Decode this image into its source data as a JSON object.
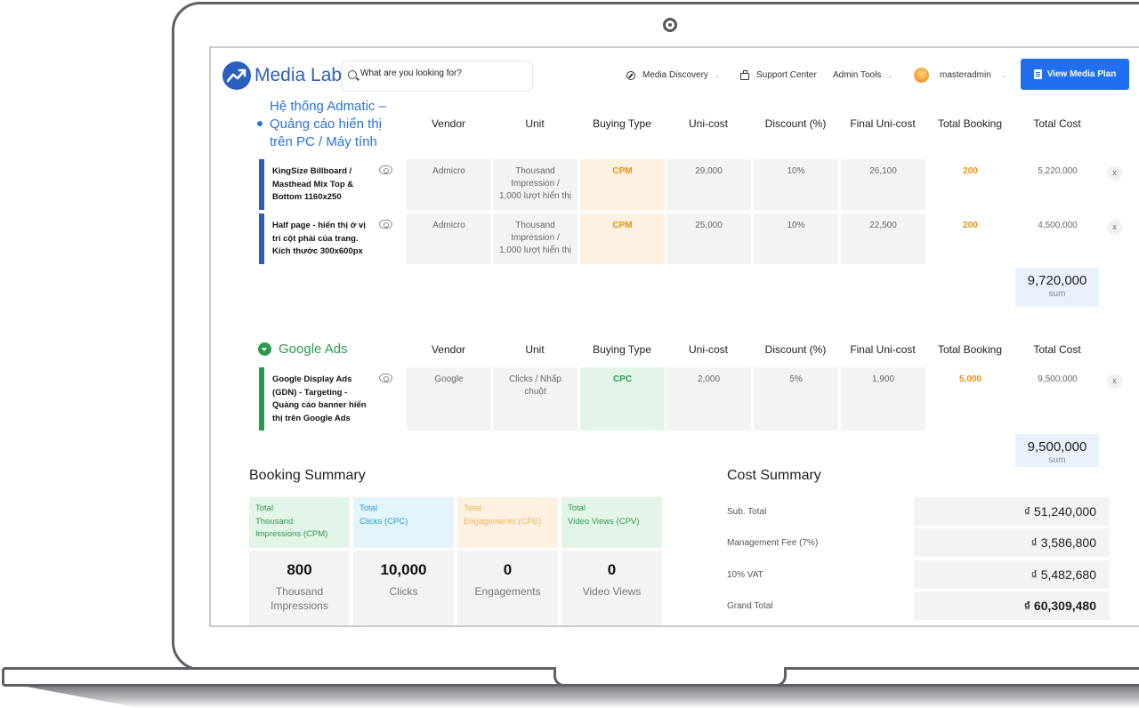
{
  "header": {
    "brand": "Media Lab",
    "search_placeholder": "What are you looking for?",
    "nav": [
      {
        "label": "Media Discovery",
        "icon": "compass-icon"
      },
      {
        "label": "Support Center",
        "icon": "bag-icon"
      },
      {
        "label": "Admin Tools",
        "icon": ""
      },
      {
        "label": "masteradmin",
        "icon": "avatar"
      }
    ],
    "plan_button": "View Media Plan",
    "accent": "#1f6ff0"
  },
  "columns": [
    "Vendor",
    "Unit",
    "Buying Type",
    "Uni-cost",
    "Discount (%)",
    "Final Uni-cost",
    "Total Booking",
    "Total Cost"
  ],
  "admatic": {
    "title_lines": [
      "Hệ thống Admatic –",
      "Quảng cáo hiển thị",
      "trên PC / Máy tính"
    ],
    "color": "#2a73d9",
    "rows": [
      {
        "name_lines": [
          "KingSize Billboard /",
          "Masthead Mix Top &",
          "Bottom 1160x250"
        ],
        "vendor": "Admicro",
        "unit_lines": [
          "Thousand",
          "Impression /",
          "1,000 lượt hiển thị"
        ],
        "buying_type": "CPM",
        "uni_cost": "29,000",
        "discount": "10%",
        "final_uni_cost": "26,100",
        "total_booking": "200",
        "total_cost": "5,220,000",
        "remove": "x"
      },
      {
        "name_lines": [
          "Half page - hiển thị ở vị",
          "trí cột phải của trang.",
          "Kích thước 300x600px"
        ],
        "vendor": "Admicro",
        "unit_lines": [
          "Thousand",
          "Impression /",
          "1,000 lượt hiển thị"
        ],
        "buying_type": "CPM",
        "uni_cost": "25,000",
        "discount": "10%",
        "final_uni_cost": "22,500",
        "total_booking": "200",
        "total_cost": "4,500,000",
        "remove": "x"
      }
    ],
    "sum_value": "9,720,000",
    "sum_label": "sum"
  },
  "google": {
    "title": "Google Ads",
    "color": "#2b9a4d",
    "rows": [
      {
        "name_lines": [
          "Google Display Ads",
          "(GDN) - Targeting -",
          "Quảng cáo banner hiển",
          "thị trên Google Ads"
        ],
        "vendor": "Google",
        "unit_lines": [
          "Clicks / Nhấp",
          "chuột"
        ],
        "buying_type": "CPC",
        "uni_cost": "2,000",
        "discount": "5%",
        "final_uni_cost": "1,900",
        "total_booking": "5,000",
        "total_cost": "9,500,000",
        "remove": "x"
      }
    ],
    "sum_value": "9,500,000",
    "sum_label": "sum"
  },
  "booking_summary": {
    "title": "Booking Summary",
    "kpis": [
      {
        "head_lines": [
          "Total",
          "Thousand",
          "Impressions (CPM)"
        ],
        "value": "800",
        "label_lines": [
          "Thousand",
          "Impressions"
        ],
        "head_bg": "#e3f4e8",
        "head_color": "#2b9a4d"
      },
      {
        "head_lines": [
          "Total",
          "Clicks (CPC)"
        ],
        "value": "10,000",
        "label_lines": [
          "Clicks"
        ],
        "head_bg": "#e3f5fb",
        "head_color": "#2a9bd6"
      },
      {
        "head_lines": [
          "Total",
          "Engagements (CPE)"
        ],
        "value": "0",
        "label_lines": [
          "Engagements"
        ],
        "head_bg": "#fdf1e1",
        "head_color": "#f0b45a"
      },
      {
        "head_lines": [
          "Total",
          "Video Views (CPV)"
        ],
        "value": "0",
        "label_lines": [
          "Video Views"
        ],
        "head_bg": "#e3f4e8",
        "head_color": "#2b9a4d"
      }
    ]
  },
  "cost_summary": {
    "title": "Cost Summary",
    "rows": [
      {
        "label": "Sub. Total",
        "value": "₫ 51,240,000"
      },
      {
        "label": "Management Fee (7%)",
        "value": "₫ 3,586,800"
      },
      {
        "label": "10% VAT",
        "value": "₫ 5,482,680"
      },
      {
        "label": "Grand Total",
        "value": "₫ 60,309,480"
      }
    ]
  }
}
